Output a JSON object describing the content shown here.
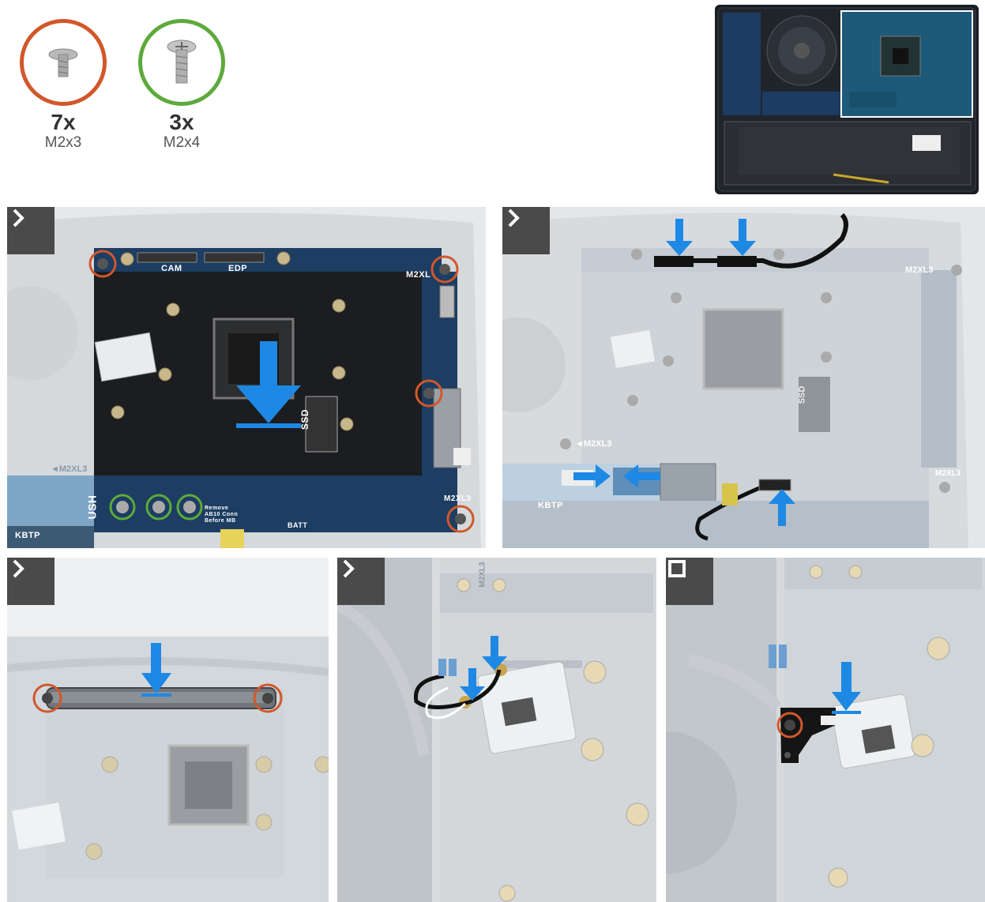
{
  "screws": [
    {
      "qty": "7x",
      "size": "M2x3",
      "ring_color": "#d2572a"
    },
    {
      "qty": "3x",
      "size": "M2x4",
      "ring_color": "#5daa3c"
    }
  ],
  "panel1": {
    "labels": {
      "cam": "CAM",
      "edp": "EDP",
      "m2xl_top": "M2XL",
      "ssd": "SSD",
      "usb": "USH",
      "m2xl3_left": "◄M2XL3",
      "m2xl3_bottom": "M2XL3",
      "kbtp": "KBTP",
      "batt": "BATT",
      "remove_note": "Remove\nAB10 Conn\nBefore MB"
    }
  },
  "panel2": {
    "labels": {
      "m2xl3_top": "M2XL3",
      "ssd": "SSD",
      "m2xl3_left": "◄M2XL3",
      "m2xl3_right": "M2XL3",
      "kbtp": "KBTP"
    }
  },
  "panel4": {
    "labels": {
      "m2xl3": "M2XL3"
    }
  },
  "colors": {
    "accent_arrow": "#1e88e5",
    "screw_orange": "#d2572a",
    "screw_green": "#5daa3c",
    "board_dark": "#1d1f22",
    "board_blue": "#1c3f66",
    "badge": "#4a4a4a"
  },
  "icons": {
    "next_step": "chevron-right-icon",
    "final_step": "square-stop-icon"
  }
}
